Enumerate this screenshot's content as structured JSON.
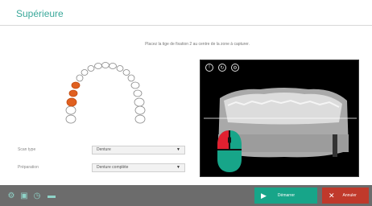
{
  "window": {
    "title": "Supérieure"
  },
  "instruction": "Placez la tige de fixation 2 au centre de la zone à capturer.",
  "form": {
    "type_label": "Scan type",
    "type_value": "Denture",
    "preparation_label": "Préparation",
    "preparation_value": "Denture complète"
  },
  "camera": {
    "buttons": [
      {
        "icon": "info-icon",
        "glyph": "!"
      },
      {
        "icon": "refresh-icon",
        "glyph": "↻"
      },
      {
        "icon": "settings-icon",
        "glyph": "⚙"
      }
    ]
  },
  "bottom": {
    "start_label": "Démarrer",
    "cancel_label": "Annuler"
  },
  "colors": {
    "accent": "#17a589",
    "cancel": "#c0392b",
    "selected_tooth": "#e06020",
    "bar": "#6c6c6c"
  }
}
